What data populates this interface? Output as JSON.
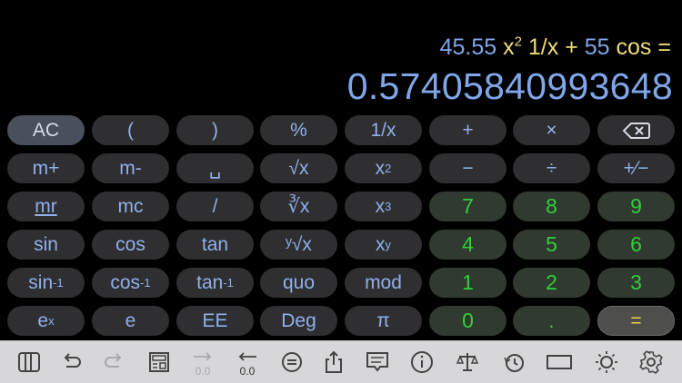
{
  "display": {
    "expression": {
      "t1": "45.55",
      "t2": "x",
      "t2sup": "2",
      "t3": "1/x",
      "t4": "+",
      "t5": "55",
      "t6": "cos",
      "t7": "="
    },
    "result": "0.57405840993648"
  },
  "keypad": {
    "r1": {
      "ac": "AC",
      "lparen": "(",
      "rparen": ")",
      "percent": "%",
      "recip": "1/x",
      "plus": "+",
      "times": "×"
    },
    "r2": {
      "mplus": "m+",
      "mminus": "m-",
      "space": "␣",
      "sqrt": "√x",
      "x2": "x",
      "x2sup": "2",
      "minus": "−",
      "divide": "÷",
      "plusminus": "+∕−"
    },
    "r3": {
      "mr": "mr",
      "mc": "mc",
      "slash": "/",
      "cbrt": "∛x",
      "x3": "x",
      "x3sup": "3",
      "d7": "7",
      "d8": "8",
      "d9": "9"
    },
    "r4": {
      "sin": "sin",
      "cos": "cos",
      "tan": "tan",
      "yroot": "ʸ√x",
      "xy": "x",
      "xysup": "y",
      "d4": "4",
      "d5": "5",
      "d6": "6"
    },
    "r5": {
      "asin": "sin",
      "asinsup": "-1",
      "acos": "cos",
      "acossup": "-1",
      "atan": "tan",
      "atansup": "-1",
      "quo": "quo",
      "mod": "mod",
      "d1": "1",
      "d2": "2",
      "d3": "3"
    },
    "r6": {
      "ex": "e",
      "exsup": "x",
      "e": "e",
      "ee": "EE",
      "deg": "Deg",
      "pi": "π",
      "d0": "0",
      "dot": ".",
      "eq": "="
    }
  },
  "toolbar": {
    "copy_label": "0.0",
    "paste_label": "0.0"
  },
  "colors": {
    "display_blue": "#7fa6e8",
    "operator_yellow": "#f0dc7a",
    "digit_green": "#2fcf3a",
    "equals_yellow": "#f5d24a"
  }
}
